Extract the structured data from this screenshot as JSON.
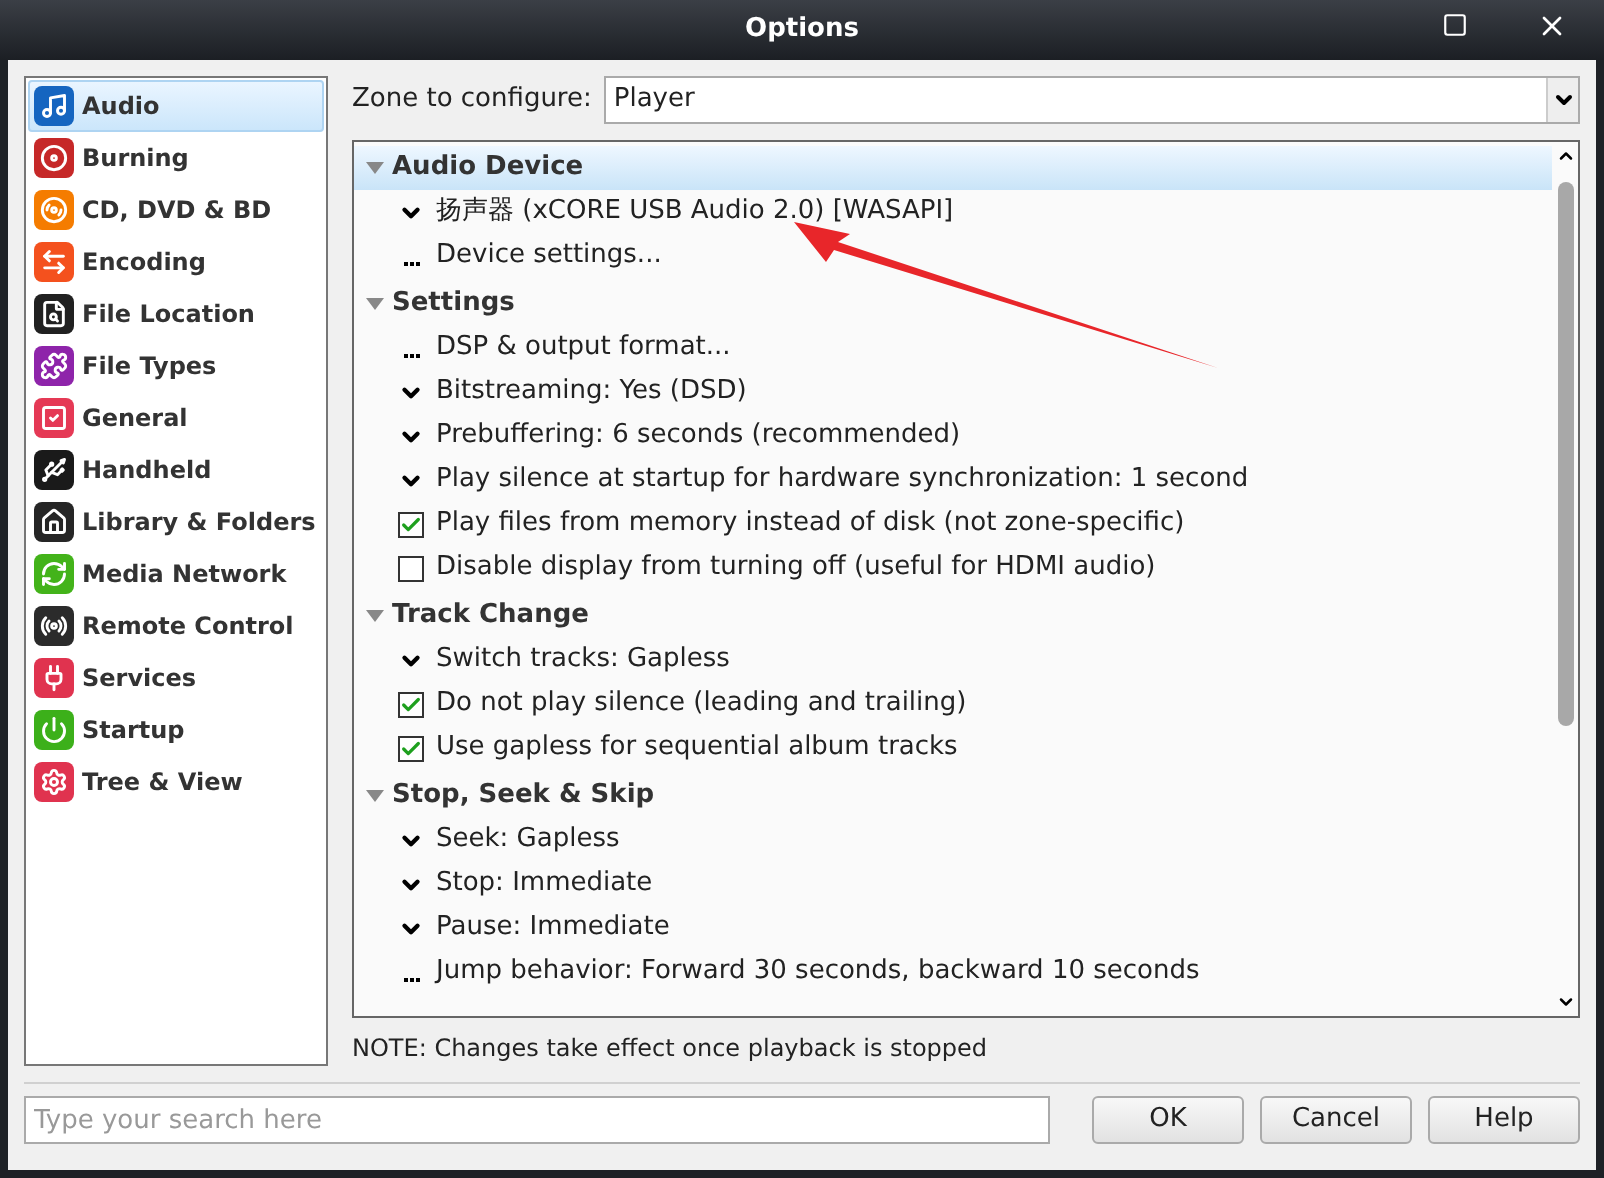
{
  "window": {
    "title": "Options"
  },
  "sidebar": {
    "items": [
      {
        "label": "Audio",
        "selected": true,
        "color": "#1565c0"
      },
      {
        "label": "Burning",
        "selected": false,
        "color": "#c62828"
      },
      {
        "label": "CD, DVD & BD",
        "selected": false,
        "color": "#f57c00"
      },
      {
        "label": "Encoding",
        "selected": false,
        "color": "#f4511e"
      },
      {
        "label": "File Location",
        "selected": false,
        "color": "#212121"
      },
      {
        "label": "File Types",
        "selected": false,
        "color": "#8e24aa"
      },
      {
        "label": "General",
        "selected": false,
        "color": "#e53955"
      },
      {
        "label": "Handheld",
        "selected": false,
        "color": "#1a1a1a"
      },
      {
        "label": "Library & Folders",
        "selected": false,
        "color": "#262626"
      },
      {
        "label": "Media Network",
        "selected": false,
        "color": "#43b31a"
      },
      {
        "label": "Remote Control",
        "selected": false,
        "color": "#2b2b2b"
      },
      {
        "label": "Services",
        "selected": false,
        "color": "#e0334f"
      },
      {
        "label": "Startup",
        "selected": false,
        "color": "#3cb01a"
      },
      {
        "label": "Tree & View",
        "selected": false,
        "color": "#e0334f"
      }
    ]
  },
  "zone": {
    "label": "Zone to configure:",
    "value": "Player"
  },
  "tree": {
    "groups": [
      {
        "title": "Audio Device",
        "selected": true,
        "expanded": true,
        "items": [
          {
            "kind": "dropdown",
            "label": "扬声器 (xCORE USB Audio 2.0) [WASAPI]"
          },
          {
            "kind": "action",
            "label": "Device settings..."
          }
        ]
      },
      {
        "title": "Settings",
        "selected": false,
        "expanded": true,
        "items": [
          {
            "kind": "action",
            "label": "DSP & output format..."
          },
          {
            "kind": "dropdown",
            "label": "Bitstreaming: Yes (DSD)"
          },
          {
            "kind": "dropdown",
            "label": "Prebuffering: 6 seconds (recommended)"
          },
          {
            "kind": "dropdown",
            "label": "Play silence at startup for hardware synchronization: 1 second"
          },
          {
            "kind": "checkbox",
            "label": "Play files from memory instead of disk (not zone-specific)",
            "checked": true
          },
          {
            "kind": "checkbox",
            "label": "Disable display from turning off (useful for HDMI audio)",
            "checked": false
          }
        ]
      },
      {
        "title": "Track Change",
        "selected": false,
        "expanded": true,
        "items": [
          {
            "kind": "dropdown",
            "label": "Switch tracks: Gapless"
          },
          {
            "kind": "checkbox",
            "label": "Do not play silence (leading and trailing)",
            "checked": true
          },
          {
            "kind": "checkbox",
            "label": "Use gapless for sequential album tracks",
            "checked": true
          }
        ]
      },
      {
        "title": "Stop, Seek & Skip",
        "selected": false,
        "expanded": true,
        "items": [
          {
            "kind": "dropdown",
            "label": "Seek: Gapless"
          },
          {
            "kind": "dropdown",
            "label": "Stop: Immediate"
          },
          {
            "kind": "dropdown",
            "label": "Pause: Immediate"
          },
          {
            "kind": "action",
            "label": "Jump behavior: Forward 30 seconds, backward 10 seconds"
          }
        ]
      }
    ]
  },
  "note": "NOTE: Changes take effect once playback is stopped",
  "search": {
    "placeholder": "Type your search here"
  },
  "buttons": [
    "OK",
    "Cancel",
    "Help"
  ]
}
